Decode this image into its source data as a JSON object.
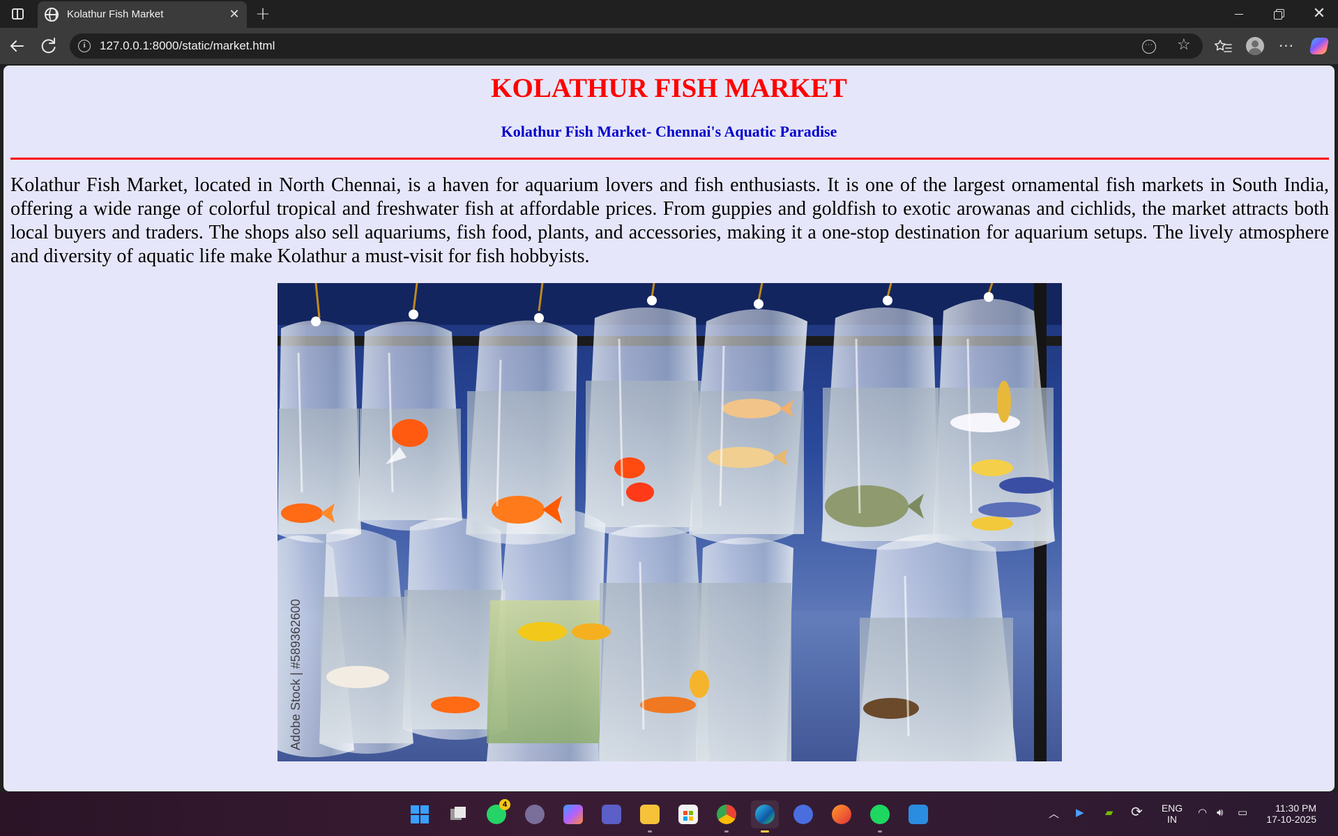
{
  "browser": {
    "tab_title": "Kolathur Fish Market",
    "tab_close_glyph": "✕",
    "new_tab_glyph": "+",
    "url": "127.0.0.1:8000/static/market.html",
    "icons": [
      "tab-actions-icon",
      "globe-icon",
      "back-arrow-icon",
      "reload-icon",
      "site-info-icon",
      "reader-mode-icon",
      "favorite-star-icon",
      "favorites-icon",
      "profile-avatar-icon",
      "more-options-icon",
      "copilot-icon"
    ]
  },
  "page": {
    "title": "KOLATHUR FISH MARKET",
    "subtitle": "Kolathur Fish Market- Chennai's Aquatic Paradise",
    "paragraph": "Kolathur Fish Market, located in North Chennai, is a haven for aquarium lovers and fish enthusiasts. It is one of the largest ornamental fish markets in South India, offering a wide range of colorful tropical and freshwater fish at affordable prices. From guppies and goldfish to exotic arowanas and cichlids, the market attracts both local buyers and traders. The shops also sell aquariums, fish food, plants, and accessories, making it a one-stop destination for aquarium setups. The lively atmosphere and diversity of aquatic life make Kolathur a must-visit for fish hobbyists.",
    "image_watermark": "Adobe Stock | #589362600",
    "colors": {
      "background": "#e6e6fa",
      "title": "#ff0000",
      "subtitle": "#0000cd",
      "rule": "#ff0000"
    }
  },
  "taskbar": {
    "apps": [
      "start-icon",
      "task-view-icon",
      "whatsapp-icon",
      "arc-app-icon",
      "copilot-app-icon",
      "teams-icon",
      "file-explorer-icon",
      "microsoft-store-icon",
      "chrome-icon",
      "edge-icon",
      "app-launcher-icon",
      "firefox-icon",
      "spotify-icon",
      "vscode-icon"
    ],
    "whatsapp_badge": "4",
    "language_line1": "ENG",
    "language_line2": "IN",
    "time": "11:30 PM",
    "date": "17-10-2025"
  }
}
